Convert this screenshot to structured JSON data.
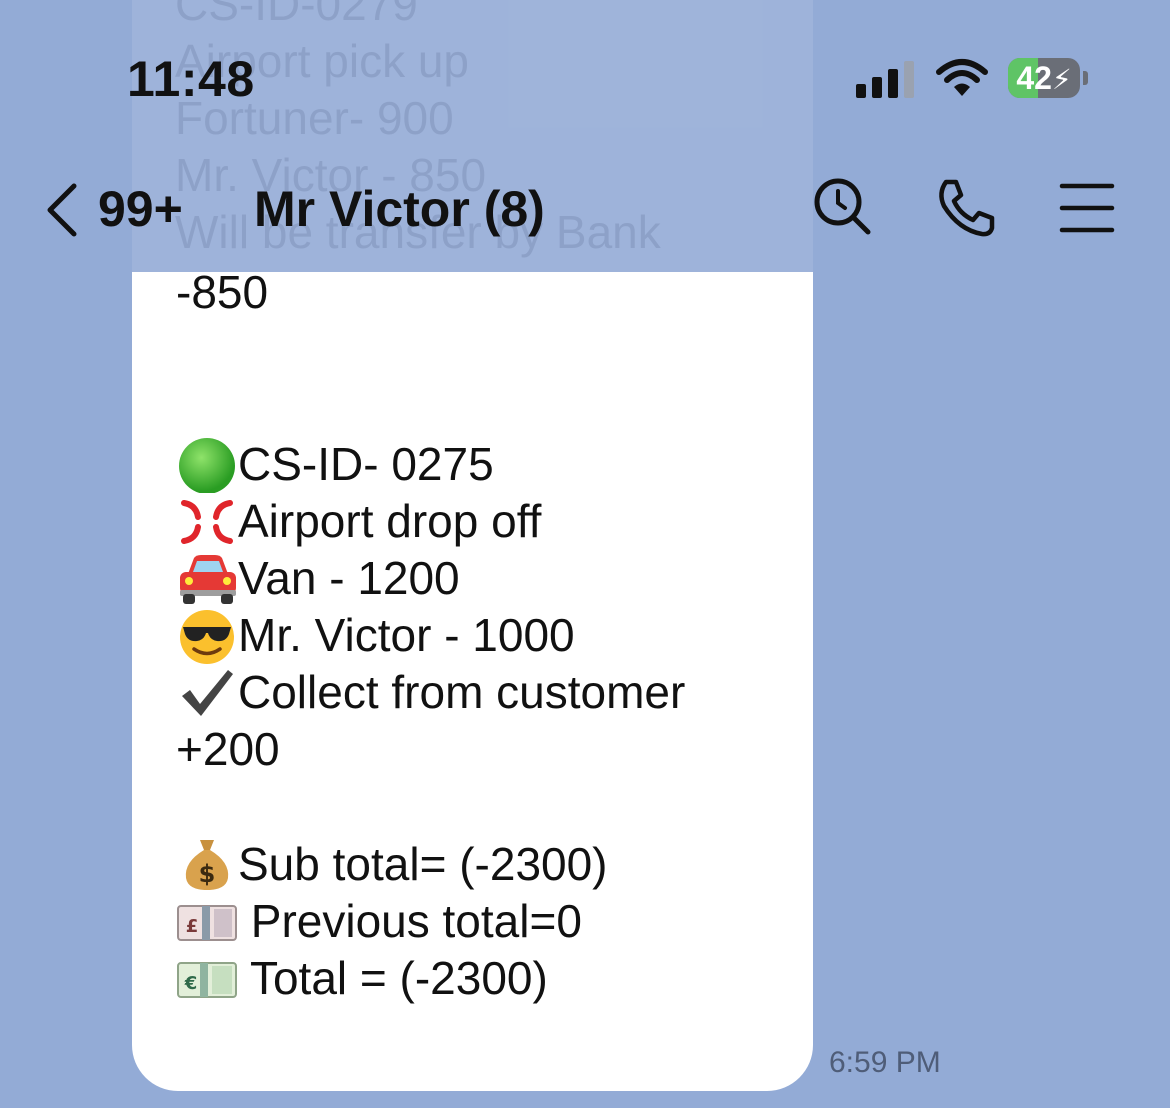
{
  "status_bar": {
    "time": "11:48",
    "battery_level": "42",
    "battery_percent": 42,
    "signal_bars": 3
  },
  "background_ghost": [
    "CS-ID-0279",
    "Airport pick up",
    "Fortuner- 900",
    "Mr. Victor - 850",
    "Will be transfer by Bank"
  ],
  "nav": {
    "back_count": "99+",
    "title": "Mr Victor  (8)"
  },
  "message": {
    "top_line": "-850",
    "booking_id": "CS-ID- 0275",
    "service": "Airport drop off",
    "vehicle": "Van  - 1200",
    "driver": "Mr. Victor - 1000",
    "collect_note": "Collect from customer",
    "collect_amount": "+200",
    "sub_total": "Sub total= (-2300)",
    "previous_total": " Previous total=0",
    "total": " Total = (-2300)",
    "time": "6:59 PM"
  },
  "colors": {
    "background": "#93abd6",
    "bubble": "#ffffff",
    "battery_fill": "#5fc466",
    "text": "#111111"
  },
  "icons": {
    "green_circle": "green-circle-icon",
    "anger": "anger-symbol-icon",
    "car": "red-car-icon",
    "sunglasses": "sunglasses-face-icon",
    "check": "check-mark-icon",
    "money_bag": "money-bag-icon",
    "pound_note": "pound-banknote-icon",
    "euro_note": "euro-banknote-icon"
  }
}
